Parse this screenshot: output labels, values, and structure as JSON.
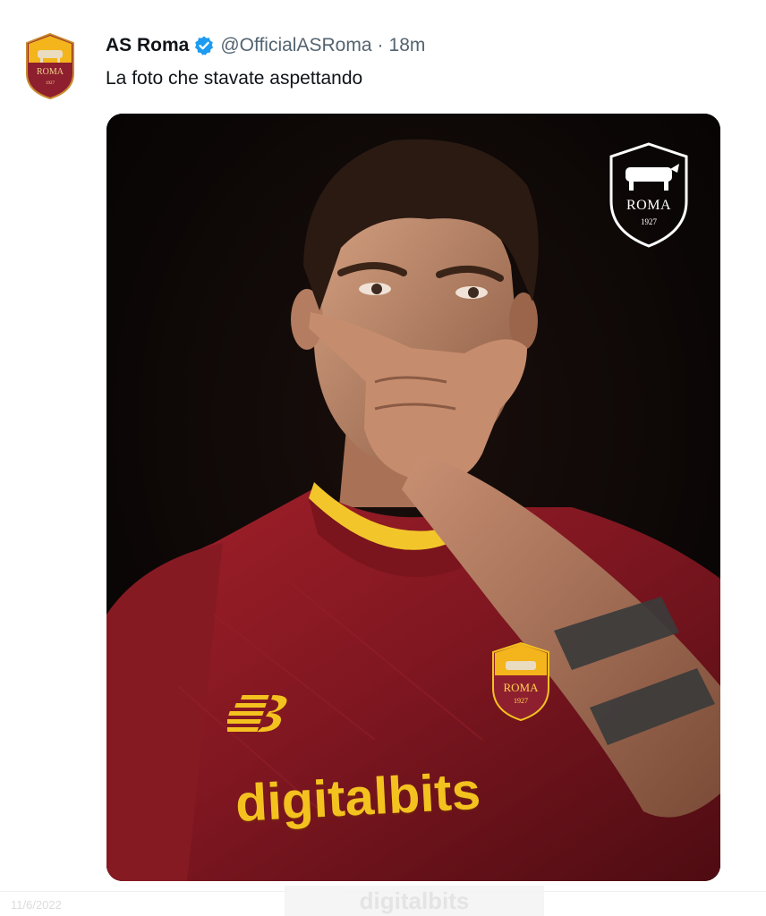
{
  "tweet": {
    "display_name": "AS Roma",
    "handle": "@OfficialASRoma",
    "separator": "·",
    "time": "18m",
    "text": "La foto che stavate aspettando",
    "verified": true,
    "icons": {
      "avatar": "as-roma-crest-icon",
      "verified": "verified-badge-icon"
    }
  },
  "media": {
    "crest_text": "ROMA",
    "crest_year": "1927",
    "shirt_crest_text": "ROMA",
    "shirt_crest_year": "1927",
    "sponsor_text": "digitalbits",
    "kit_logo": "new-balance-logo"
  },
  "footer": {
    "date_text": "11/6/2022",
    "watermark_text": "digitalbits"
  },
  "colors": {
    "verified_blue": "#1d9bf0",
    "handle_gray": "#536471",
    "roma_red": "#8e1f2f",
    "roma_yellow": "#f3c21f"
  }
}
